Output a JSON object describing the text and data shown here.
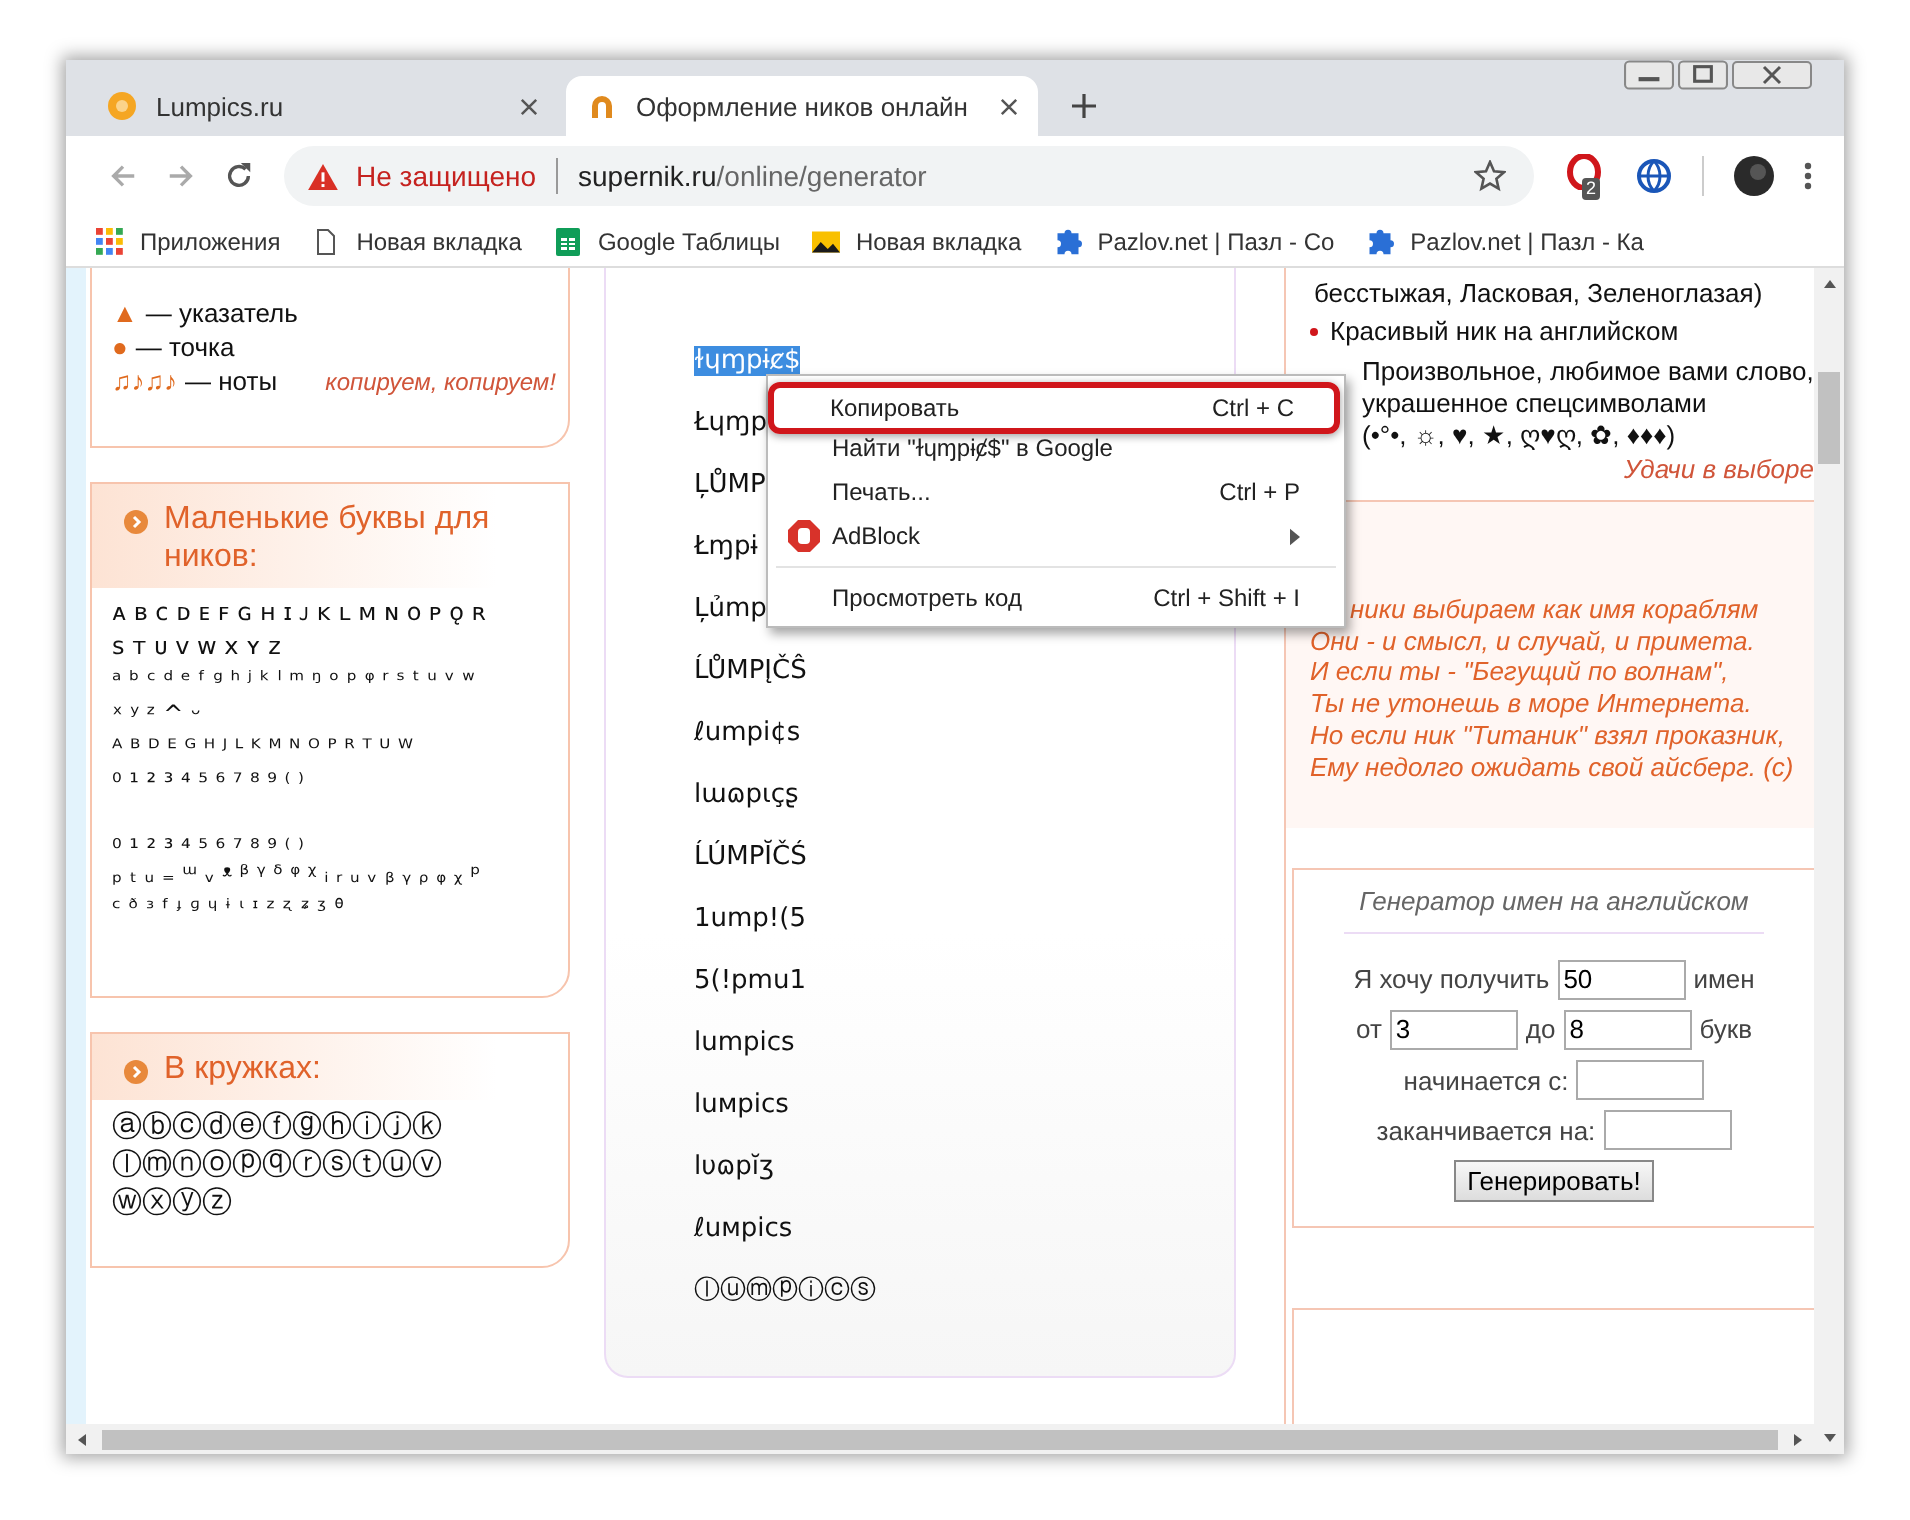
{
  "browser": {
    "tabs": [
      {
        "title": "Lumpics.ru",
        "selected": false
      },
      {
        "title": "Оформление ников онлайн",
        "selected": true
      }
    ],
    "address": {
      "security": "Не защищено",
      "domain": "supernik.ru",
      "path": "/online/generator"
    },
    "extension_badge": "2",
    "bookmarks": [
      {
        "kind": "apps",
        "label": "Приложения"
      },
      {
        "kind": "page",
        "label": "Новая вкладка"
      },
      {
        "kind": "sheets",
        "label": "Google Таблицы"
      },
      {
        "kind": "image",
        "label": "Новая вкладка"
      },
      {
        "kind": "puzzle",
        "label": "Pazlov.net | Пазл - Co"
      },
      {
        "kind": "puzzle",
        "label": "Pazlov.net | Пазл - Ка"
      }
    ]
  },
  "left": {
    "symbols": [
      {
        "glyph": "▲",
        "label": "— указатель"
      },
      {
        "glyph": "●",
        "label": "— точка"
      },
      {
        "glyph": "♫♪♫♪",
        "label": "— ноты"
      }
    ],
    "symbols_note": "копируем, копируем!",
    "small_letters": {
      "title": "Маленькие буквы для ников:",
      "lines": [
        "ᴀ ʙ ᴄ ᴅ ᴇ ꜰ ɢ ʜ ɪ ᴊ ᴋ ʟ ᴍ ɴ ᴏ ᴘ ǫ ʀ",
        "ꜱ ᴛ ᴜ ᴠ ᴡ x ʏ ᴢ",
        "ᵃ ᵇ ᶜ ᵈ ᵉ ᶠ ᵍ ʰ ʲ ᵏ ˡ ᵐ ᵑ ᵒ ᵖ ᵠ ʳ ˢ ᵗ ᵘ ᵛ ʷ",
        "ˣ ʸ ᶻ ^ ᵕ",
        "ᴬ ᴮ ᴰ ᴱ ᴳ ᴴ ᴶ ᴸ ᴷ ᴹ ᴺ ᴼ ᴾ ᴿ ᵀ ᵁ ᵂ",
        "⁰ ¹ ² ³ ⁴ ⁵ ⁶ ⁷ ⁸ ⁹ ⁽ ⁾",
        "₀ ₁ ₂ ₃ ₄ ₅ ₆ ₇ ₈ ₉ ₍ ₎",
        "ₚ ₜ ᵤ ₌ ᵚ ᵥ ᵜ ᵝ ᵞ ᵟ ᵠ ᵡ ᵢ ᵣ ᵤ ᵥ ᵦ ᵧ ᵨ ᵩ ᵪ ᵖ",
        "ᶜ ᶞ ᶟ ᶠ ᶡ ᶢ ᶣ ᶤ ᶥ ᶦ ᶻ ᶼ ᶽ ᶾ ᶿ"
      ]
    },
    "circled": {
      "title": "В кружках:",
      "lines": [
        "ⓐⓑⓒⓓⓔⓕⓖⓗⓘⓙⓚ",
        "ⓛⓜⓝⓞⓟⓠⓡⓢⓣⓤⓥ",
        "ⓦⓧⓨⓩ"
      ]
    }
  },
  "nicks": [
    {
      "text": "ɫɥɱpɨȼ$",
      "selected": true
    },
    {
      "text": "Łɥɱp",
      "selected": false
    },
    {
      "text": "ĻŮMP",
      "selected": false
    },
    {
      "text": "Łɱpɨ",
      "selected": false
    },
    {
      "text": "Ļủmp",
      "selected": false
    },
    {
      "text": "ĹŮMPĮČŜ",
      "selected": false
    },
    {
      "text": "ℓumpi¢s",
      "selected": false
    },
    {
      "text": "lɯɷpɩçʂ",
      "selected": false
    },
    {
      "text": "ĹÚMPĬČŚ",
      "selected": false
    },
    {
      "text": "1ump!(5",
      "selected": false
    },
    {
      "text": "5(!pmu1",
      "selected": false
    },
    {
      "text": "lumpics",
      "selected": false
    },
    {
      "text": "luмpics",
      "selected": false
    },
    {
      "text": "lυɷpĭʒ",
      "selected": false
    },
    {
      "text": "ℓuмpics",
      "selected": false
    },
    {
      "text": "ⓛⓤⓜⓟⓘⓒⓢ",
      "selected": false
    }
  ],
  "context_menu": [
    {
      "kind": "item",
      "label": "Копировать",
      "shortcut": "Ctrl + C",
      "highlighted": true
    },
    {
      "kind": "item",
      "label": "Найти \"ɫɥɱpɨȼ$\" в Google",
      "highlighted": false
    },
    {
      "kind": "item",
      "label": "Печать...",
      "shortcut": "Ctrl + P",
      "highlighted": false
    },
    {
      "kind": "submenu",
      "label": "AdBlock",
      "highlighted": false
    },
    {
      "kind": "separator"
    },
    {
      "kind": "item",
      "label": "Просмотреть код",
      "shortcut": "Ctrl + Shift + I",
      "highlighted": false
    }
  ],
  "right": {
    "top_line": "бесстыжая, Ласковая, Зеленоглазая)",
    "bullet": "Красивый ник на английском",
    "symbol_lines": [
      "Произвольное, любимое вами слово,",
      "украшенное спецсимволами",
      "(•°•, ☼, ♥, ★, ღ♥ღ, ✿, ♦♦♦)"
    ],
    "wish": "Удачи в выборе",
    "poem": [
      "ники выбираем как имя кораблям",
      "Они - и смысл, и случай, и примета.",
      "И если ты - \"Бегущий по волнам\",",
      "Ты не утонешь в море Интернета.",
      "Но если ник \"Титаник\" взял проказник,",
      "Ему недолго ожидать свой айсберг. (с)"
    ],
    "generator": {
      "title": "Генератор имен на английском",
      "want": "Я хочу получить",
      "count": "50",
      "names": "имен",
      "from": "от",
      "min": "3",
      "to": "до",
      "max": "8",
      "letters": "букв",
      "starts": "начинается с:",
      "ends": "заканчивается на:",
      "button": "Генерировать!"
    }
  }
}
